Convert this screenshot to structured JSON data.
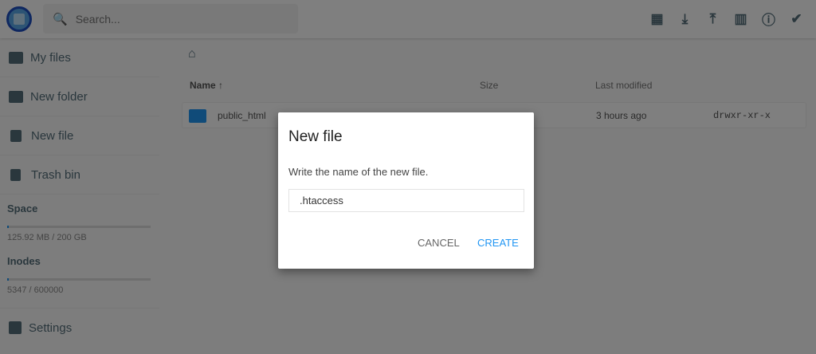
{
  "header": {
    "search_placeholder": "Search...",
    "icons": [
      "grid-view-icon",
      "download-icon",
      "upload-icon",
      "chart-icon",
      "info-icon",
      "check-circle-icon"
    ]
  },
  "sidebar": {
    "items": [
      {
        "label": "My files"
      },
      {
        "label": "New folder"
      },
      {
        "label": "New file"
      },
      {
        "label": "Trash bin"
      }
    ],
    "space": {
      "label": "Space",
      "value": "125.92 MB / 200 GB",
      "fraction": 0.0006
    },
    "inodes": {
      "label": "Inodes",
      "value": "5347 / 600000",
      "fraction": 0.0089
    },
    "settings": "Settings"
  },
  "listing": {
    "columns": {
      "name": "Name",
      "name_sort": "↑",
      "size": "Size",
      "modified": "Last modified"
    },
    "rows": [
      {
        "name": "public_html",
        "modified": "3 hours ago",
        "permissions": "drwxr-xr-x"
      }
    ]
  },
  "dialog": {
    "title": "New file",
    "message": "Write the name of the new file.",
    "input_value": ".htaccess",
    "cancel": "CANCEL",
    "create": "CREATE"
  },
  "colors": {
    "accent": "#2196f3",
    "icon": "#546e7a"
  }
}
